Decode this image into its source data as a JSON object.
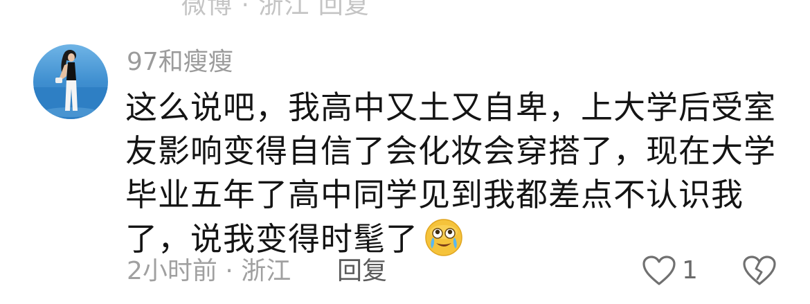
{
  "top_clipped_text": "微博 · 浙江 回复",
  "comment": {
    "username": "97和瘦瘦",
    "text_lines": [
      "这么说吧，我高中又土又自卑，上大学后受室",
      "友影响变得自信了会化妆会穿搭了，现在大学",
      "毕业五年了高中同学见到我都差点不认识我",
      "了，说我变得时髦了"
    ],
    "emoji": "laugh-cry-emoji",
    "time_location": "2小时前 · 浙江",
    "reply_label": "回复",
    "like_count": "1"
  },
  "colors": {
    "username": "#9b9b9b",
    "body_text": "#141414",
    "meta": "#a0a0a0",
    "emoji_face": "#f5c33b"
  }
}
